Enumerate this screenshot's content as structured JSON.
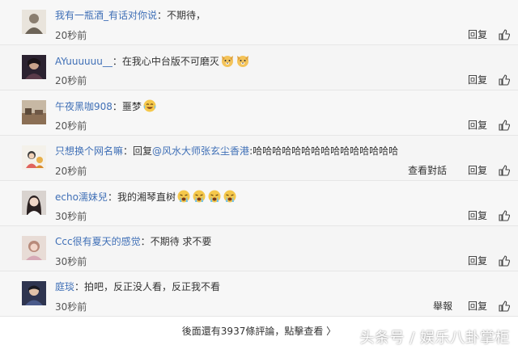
{
  "comments": [
    {
      "username": "我有一瓶酒_有话对你说",
      "separator": "：",
      "text": "不期待，",
      "time": "20秒前",
      "reply_label": "回复"
    },
    {
      "username": "AYuuuuuu__",
      "separator": "：",
      "text": "在我心中台版不可磨灭",
      "emojis": [
        "dog-face-icon",
        "dog-face-icon"
      ],
      "time": "20秒前",
      "reply_label": "回复"
    },
    {
      "username": "午夜黑咖908",
      "separator": "：",
      "text": "噩梦",
      "emojis": [
        "laughing-tears-icon"
      ],
      "time": "20秒前",
      "reply_label": "回复"
    },
    {
      "username": "只想换个网名嘛",
      "separator": "：",
      "reply_prefix": "回复",
      "reply_target": "@风水大师张玄尘香港",
      "text": ":哈哈哈哈哈哈哈哈哈哈哈哈哈哈哈",
      "time": "20秒前",
      "view_label": "查看對話",
      "reply_label": "回复"
    },
    {
      "username": "echo濡妹兒",
      "separator": "：",
      "text": "我的湘琴直树",
      "emojis": [
        "crying-face-icon",
        "crying-face-icon",
        "crying-face-icon",
        "crying-face-icon"
      ],
      "time": "30秒前",
      "reply_label": "回复"
    },
    {
      "username": "Ccc很有夏天的感觉",
      "separator": "：",
      "text": "不期待 求不要",
      "time": "30秒前",
      "reply_label": "回复"
    },
    {
      "username": "庭琰",
      "separator": "：",
      "text": "拍吧，反正没人看，反正我不看",
      "time": "30秒前",
      "report_label": "舉報",
      "reply_label": "回复"
    }
  ],
  "more_text": "後面還有3937條評論，點擊查看",
  "more_arrow": "〉",
  "watermark": "头条号 / 娱乐八卦掌柜",
  "colors": {
    "username": "#3f6fb6",
    "text": "#333333",
    "row_bg": "#f5f5f5",
    "divider": "#e6e6e6"
  }
}
